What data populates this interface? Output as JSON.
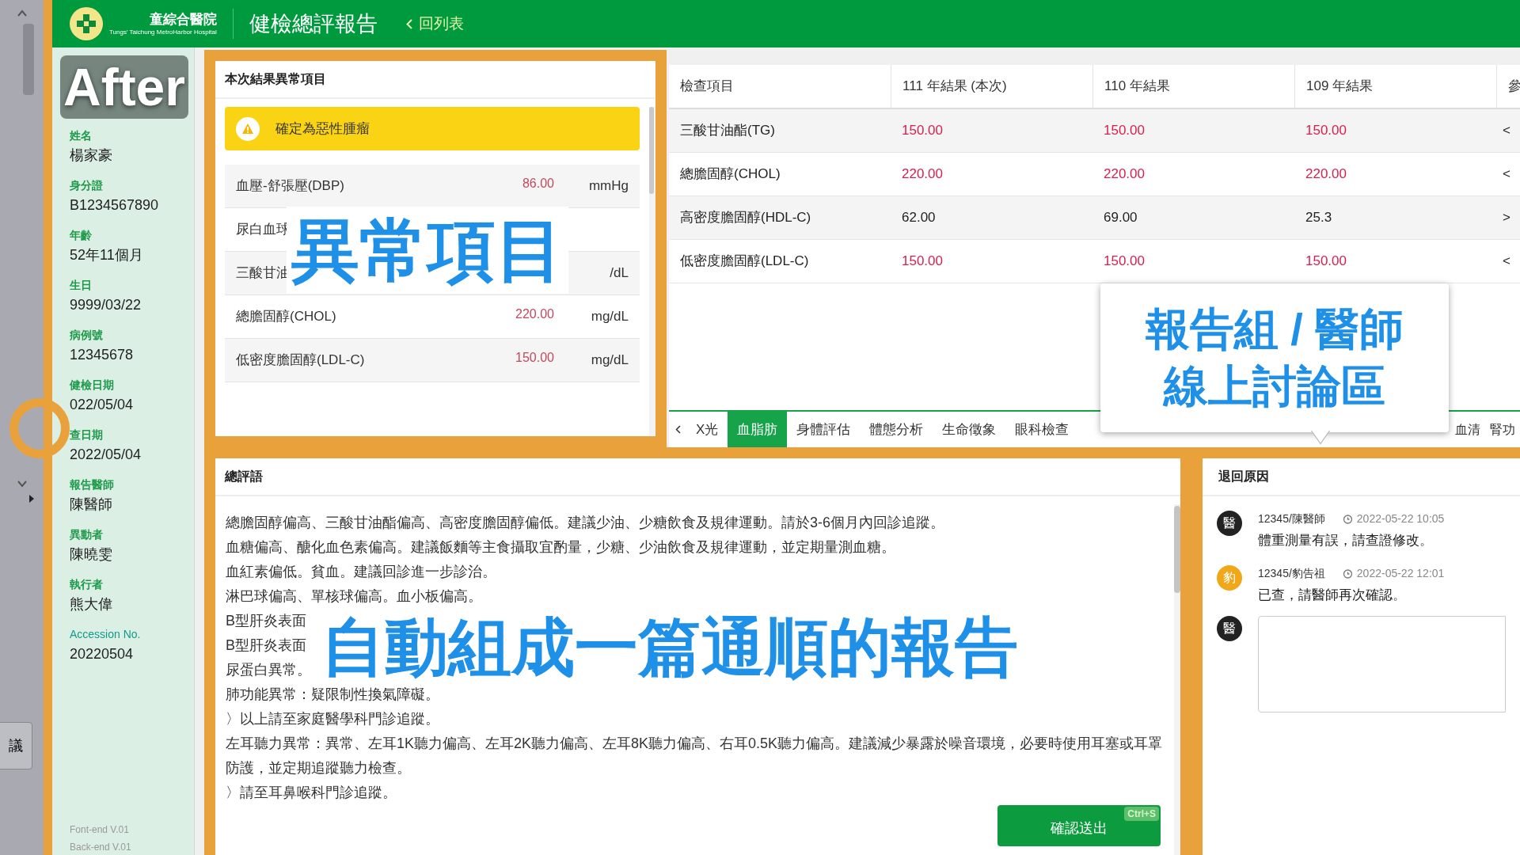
{
  "header": {
    "hospital_name": "童綜合醫院",
    "hospital_name_en": "Tungs' Taichung MetroHarbor Hospital",
    "title": "健檢總評報告",
    "back_link": "回列表"
  },
  "left_strip": {
    "button_label": "議"
  },
  "sidebar": {
    "fields": [
      {
        "label": "姓名",
        "value": "楊家豪"
      },
      {
        "label": "身分證",
        "value": "B1234567890"
      },
      {
        "label": "年齡",
        "value": "52年11個月"
      },
      {
        "label": "生日",
        "value": "9999/03/22"
      },
      {
        "label": "病例號",
        "value": "12345678"
      },
      {
        "label": "健檢日期",
        "value": "022/05/04"
      },
      {
        "label": "查日期",
        "value": "2022/05/04"
      },
      {
        "label": "報告醫師",
        "value": "陳醫師"
      },
      {
        "label": "異動者",
        "value": "陳曉雯"
      },
      {
        "label": "執行者",
        "value": "熊大偉"
      },
      {
        "label": "Accession No.",
        "value": "20220504"
      }
    ],
    "versions": [
      "Font-end V.01",
      "Back-end V.01"
    ]
  },
  "abnormal_panel": {
    "title": "本次結果異常項目",
    "alert": "確定為惡性腫瘤",
    "items": [
      {
        "name": "血壓-舒張壓(DBP)",
        "value": "86.00",
        "unit": "mmHg"
      },
      {
        "name": "尿白血球"
      },
      {
        "name": "三酸甘油",
        "unit": "/dL"
      },
      {
        "name": "總膽固醇(CHOL)",
        "value": "220.00",
        "unit": "mg/dL"
      },
      {
        "name": "低密度膽固醇(LDL-C)",
        "value": "150.00",
        "unit": "mg/dL"
      }
    ]
  },
  "results_table": {
    "columns": [
      "檢查項目",
      "111 年結果 (本次)",
      "110 年結果",
      "109 年結果",
      "參"
    ],
    "rows": [
      {
        "cells": [
          {
            "text": "三酸甘油酯(TG)",
            "abnormal": false
          },
          {
            "text": "150.00",
            "abnormal": true
          },
          {
            "text": "150.00",
            "abnormal": true
          },
          {
            "text": "150.00",
            "abnormal": true
          },
          {
            "text": "<",
            "abnormal": false
          }
        ]
      },
      {
        "cells": [
          {
            "text": "總膽固醇(CHOL)",
            "abnormal": false
          },
          {
            "text": "220.00",
            "abnormal": true
          },
          {
            "text": "220.00",
            "abnormal": true
          },
          {
            "text": "220.00",
            "abnormal": true
          },
          {
            "text": "<",
            "abnormal": false
          }
        ]
      },
      {
        "cells": [
          {
            "text": "高密度膽固醇(HDL-C)",
            "abnormal": false
          },
          {
            "text": "62.00",
            "abnormal": false
          },
          {
            "text": "69.00",
            "abnormal": false
          },
          {
            "text": "25.3",
            "abnormal": false
          },
          {
            "text": ">",
            "abnormal": false
          }
        ]
      },
      {
        "cells": [
          {
            "text": "低密度膽固醇(LDL-C)",
            "abnormal": false
          },
          {
            "text": "150.00",
            "abnormal": true
          },
          {
            "text": "150.00",
            "abnormal": true
          },
          {
            "text": "150.00",
            "abnormal": true
          },
          {
            "text": "<",
            "abnormal": false
          }
        ]
      }
    ]
  },
  "tabs": [
    {
      "label": "X光",
      "selected": false
    },
    {
      "label": "血脂肪",
      "selected": true
    },
    {
      "label": "身體評估",
      "selected": false
    },
    {
      "label": "體態分析",
      "selected": false
    },
    {
      "label": "生命徵象",
      "selected": false
    },
    {
      "label": "眼科檢查",
      "selected": false
    }
  ],
  "tabs_right": [
    {
      "label": "血清",
      "selected": false
    },
    {
      "label": "腎功",
      "selected": false
    }
  ],
  "summary": {
    "title": "總評語",
    "lines": [
      "總膽固醇偏高、三酸甘油酯偏高、高密度膽固醇偏低。建議少油、少糖飲食及規律運動。請於3-6個月內回診追蹤。",
      "血糖偏高、醣化血色素偏高。建議飯麵等主食攝取宜酌量，少糖、少油飲食及規律運動，並定期量測血糖。",
      "血紅素偏低。貧血。建議回診進一步診治。",
      "淋巴球偏高、單核球偏高。血小板偏高。",
      "B型肝炎表面",
      "B型肝炎表面",
      "尿蛋白異常。",
      "肺功能異常：疑限制性換氣障礙。",
      "〉以上請至家庭醫學科門診追蹤。",
      "左耳聽力異常：異常、左耳1K聽力偏高、左耳2K聽力偏高、左耳8K聽力偏高、右耳0.5K聽力偏高。建議減少暴露於噪音環境，必要時使用耳塞或耳罩防護，並定期追蹤聽力檢查。",
      "〉請至耳鼻喉科門診追蹤。"
    ],
    "submit_button": "確認送出",
    "shortcut": "Ctrl+S"
  },
  "comments_panel": {
    "title": "退回原因",
    "comments": [
      {
        "avatar": "醫",
        "color": "#222222",
        "author": "12345/陳醫師",
        "time": "2022-05-22 10:05",
        "text": "體重測量有誤，請查證修改。"
      },
      {
        "avatar": "豹",
        "color": "#f0a818",
        "author": "12345/豹告祖",
        "time": "2022-05-22 12:01",
        "text": "已查，請醫師再次確認。"
      }
    ],
    "reply_avatar": {
      "text": "醫",
      "color": "#222222"
    }
  },
  "annotations": {
    "after": "After",
    "abnormal": "異常項目",
    "discussion": [
      "報告組 / 醫師",
      "線上討論區"
    ],
    "report": "自動組成一篇通順的報告"
  }
}
